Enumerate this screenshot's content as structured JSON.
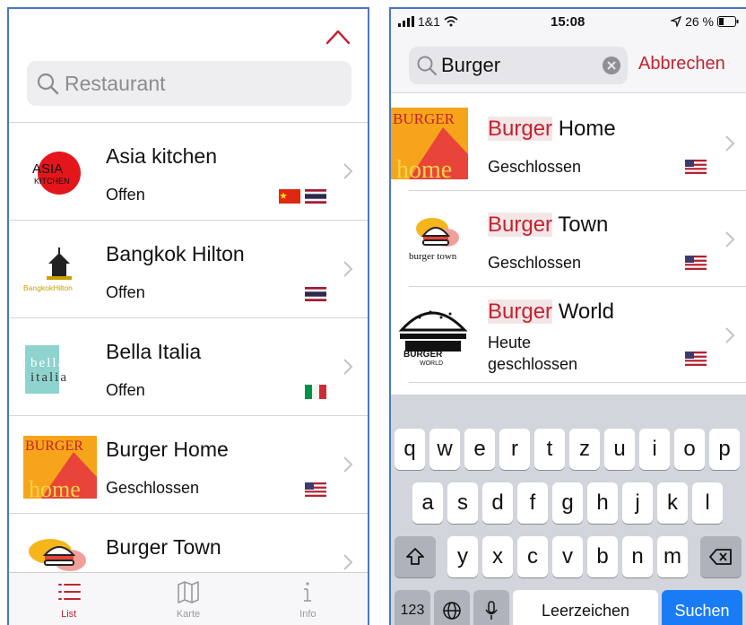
{
  "left": {
    "search_placeholder": "Restaurant",
    "restaurants": [
      {
        "name": "Asia kitchen",
        "status": "Offen",
        "flags": [
          "china",
          "thailand"
        ],
        "logo_text": [
          "ASIA",
          "KITCHEN"
        ]
      },
      {
        "name": "Bangkok Hilton",
        "status": "Offen",
        "flags": [
          "thailand"
        ],
        "logo_text": [
          "BangkokHilton"
        ]
      },
      {
        "name": "Bella Italia",
        "status": "Offen",
        "flags": [
          "italy"
        ],
        "logo_text": [
          "bella",
          "italia"
        ]
      },
      {
        "name": "Burger Home",
        "status": "Geschlossen",
        "flags": [
          "usa"
        ],
        "logo_text": [
          "BURGER",
          "home"
        ]
      },
      {
        "name": "Burger Town",
        "status": "",
        "flags": [],
        "logo_text": []
      }
    ],
    "tabs": [
      {
        "label": "List",
        "icon": "list-icon",
        "active": true
      },
      {
        "label": "Karte",
        "icon": "map-icon",
        "active": false
      },
      {
        "label": "Info",
        "icon": "info-icon",
        "active": false
      }
    ]
  },
  "right": {
    "status_bar": {
      "carrier": "1&1",
      "time": "15:08",
      "battery": "26 %"
    },
    "search_value": "Burger",
    "cancel_label": "Abbrechen",
    "results": [
      {
        "highlight": "Burger",
        "rest": " Home",
        "status": "Geschlossen",
        "flag": "usa",
        "logo_text": [
          "BURGER",
          "home"
        ]
      },
      {
        "highlight": "Burger",
        "rest": " Town",
        "status": "Geschlossen",
        "flag": "usa",
        "logo_text": [
          "burger town"
        ]
      },
      {
        "highlight": "Burger",
        "rest": " World",
        "status_lines": [
          "Heute",
          "geschlossen"
        ],
        "flag": "usa",
        "logo_text": [
          "BURGER",
          "WORLD"
        ]
      }
    ],
    "keyboard": {
      "row1": [
        "q",
        "w",
        "e",
        "r",
        "t",
        "z",
        "u",
        "i",
        "o",
        "p"
      ],
      "row2": [
        "a",
        "s",
        "d",
        "f",
        "g",
        "h",
        "j",
        "k",
        "l"
      ],
      "row3": [
        "y",
        "x",
        "c",
        "v",
        "b",
        "n",
        "m"
      ],
      "numbers_label": "123",
      "space_label": "Leerzeichen",
      "search_label": "Suchen"
    }
  },
  "colors": {
    "accent": "#c3232e",
    "key_blue": "#1a7cf5",
    "frame": "#4a78c2"
  }
}
